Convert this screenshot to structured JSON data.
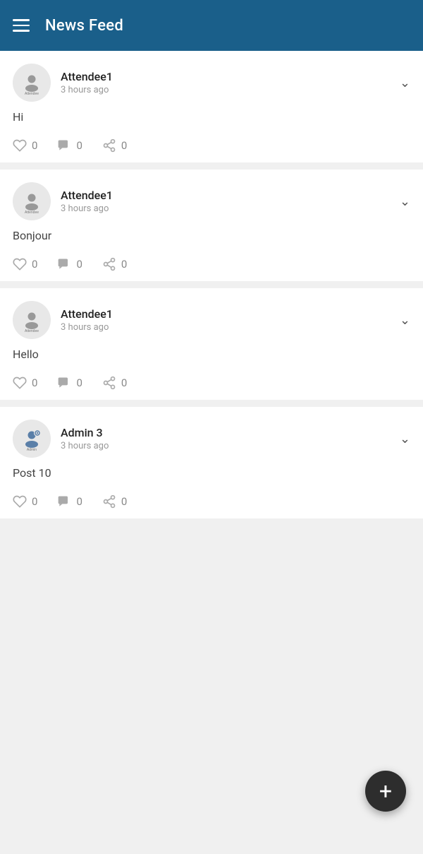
{
  "header": {
    "title": "News Feed",
    "menu_icon": "hamburger-icon"
  },
  "posts": [
    {
      "id": 1,
      "author": "Attendee1",
      "time": "3 hours ago",
      "content": "Hi",
      "likes": 0,
      "comments": 0,
      "shares": 0,
      "avatar_type": "attendee"
    },
    {
      "id": 2,
      "author": "Attendee1",
      "time": "3 hours ago",
      "content": "Bonjour",
      "likes": 0,
      "comments": 0,
      "shares": 0,
      "avatar_type": "attendee"
    },
    {
      "id": 3,
      "author": "Attendee1",
      "time": "3 hours ago",
      "content": "Hello",
      "likes": 0,
      "comments": 0,
      "shares": 0,
      "avatar_type": "attendee"
    },
    {
      "id": 4,
      "author": "Admin 3",
      "time": "3 hours ago",
      "content": "Post 10",
      "likes": 0,
      "comments": 0,
      "shares": 0,
      "avatar_type": "admin"
    }
  ],
  "fab": {
    "label": "+"
  }
}
